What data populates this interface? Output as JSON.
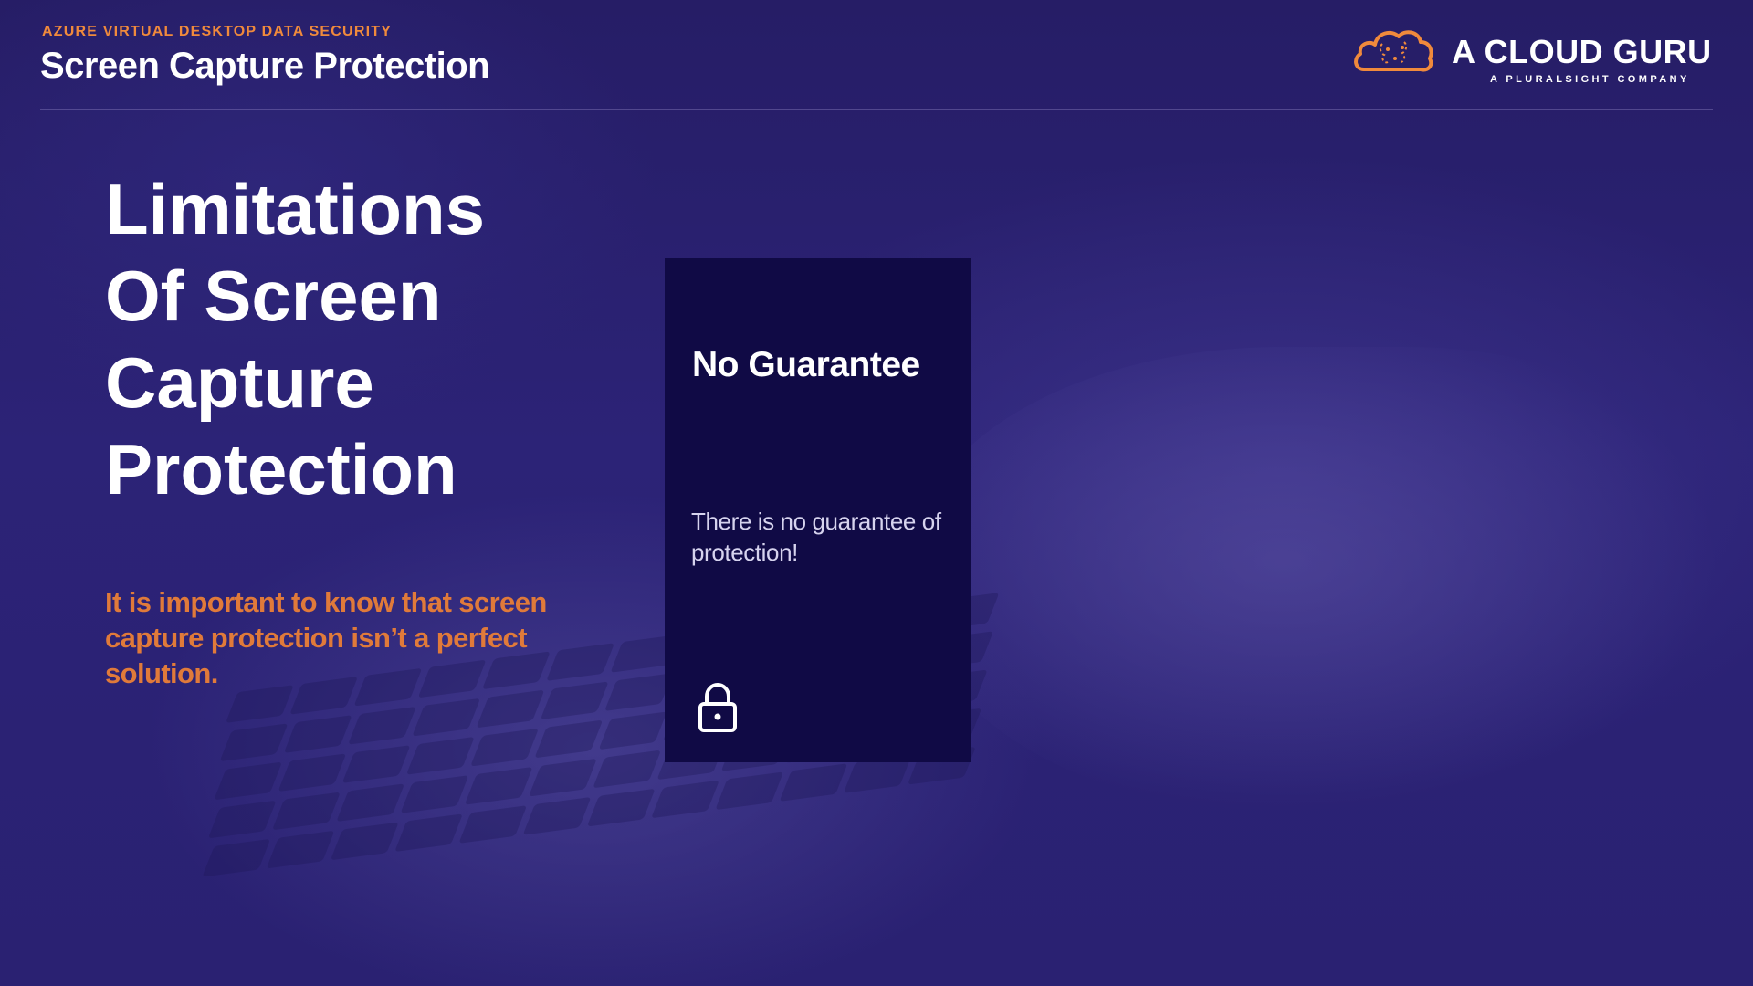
{
  "header": {
    "eyebrow": "AZURE VIRTUAL DESKTOP DATA SECURITY",
    "title": "Screen Capture Protection"
  },
  "logo": {
    "name": "A CLOUD GURU",
    "tagline": "A PLURALSIGHT COMPANY",
    "icon": "cloud-brain-icon"
  },
  "main": {
    "heading_lines": [
      "Limitations",
      "Of Screen",
      "Capture",
      "Protection"
    ],
    "callout": "It is important to know that screen capture protection isn’t a perfect solution."
  },
  "card": {
    "title": "No Guarantee",
    "body": "There is no guarantee of protection!",
    "icon": "lock-icon"
  },
  "colors": {
    "background": "#2a2172",
    "card_background": "#100a45",
    "accent_orange": "#f08a3c",
    "text_white": "#ffffff"
  }
}
